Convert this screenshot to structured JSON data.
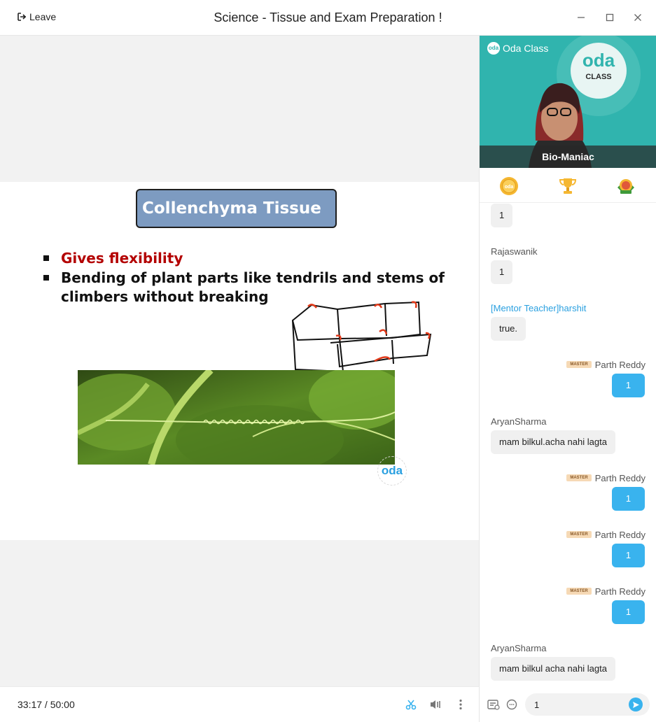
{
  "window": {
    "leave_label": "Leave",
    "title": "Science - Tissue and Exam Preparation !"
  },
  "slide": {
    "title": "Collenchyma Tissue",
    "bullets": [
      "Gives flexibility",
      " Bending of plant parts like tendrils and stems of climbers without breaking"
    ],
    "watermark": "oda"
  },
  "player": {
    "time": "33:17 / 50:00"
  },
  "video": {
    "brand": "Oda Class",
    "brand_badge": "oda",
    "teacher_name": "Bio-Maniac"
  },
  "chat": {
    "master_badge": "MASTER",
    "messages": [
      {
        "sender": "",
        "text": "1",
        "mine": false
      },
      {
        "sender": "Rajaswanik",
        "text": "1",
        "mine": false
      },
      {
        "sender": "[Mentor Teacher]harshit",
        "text": "true.",
        "mine": false
      },
      {
        "sender": "Parth Reddy",
        "text": "1",
        "mine": true
      },
      {
        "sender": "AryanSharma",
        "text": "mam bilkul.acha nahi lagta",
        "mine": false
      },
      {
        "sender": "Parth Reddy",
        "text": "1",
        "mine": true
      },
      {
        "sender": "Parth Reddy",
        "text": "1",
        "mine": true
      },
      {
        "sender": "Parth Reddy",
        "text": "1",
        "mine": true
      },
      {
        "sender": "AryanSharma",
        "text": "mam bilkul acha nahi lagta",
        "mine": false
      }
    ],
    "input_value": "1"
  },
  "colors": {
    "accent": "#39b3ee",
    "slide_title_bg": "#7d9bc1",
    "bullet_red": "#b30000",
    "teal": "#2fb5b0"
  },
  "icons": {
    "leave": "leave-icon",
    "minimize": "minimize-icon",
    "maximize": "maximize-icon",
    "close": "close-icon",
    "cut": "scissors-icon",
    "volume": "volume-icon",
    "more": "more-vertical-icon",
    "coin": "coin-icon",
    "trophy": "trophy-icon",
    "badge": "badge-icon",
    "notes": "notes-icon",
    "emoji": "chat-bubble-icon",
    "send": "send-icon"
  }
}
